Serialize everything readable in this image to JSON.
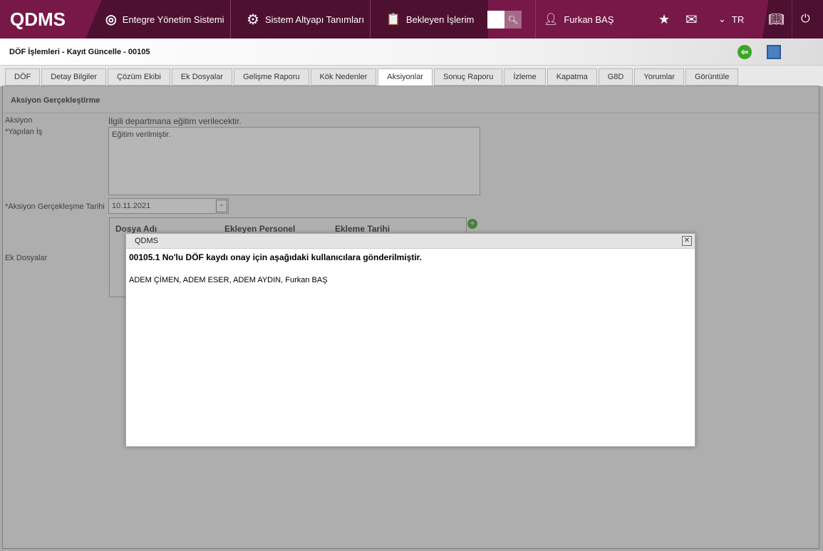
{
  "nav": {
    "logo": "QDMS",
    "items": [
      "Entegre Yönetim Sistemi",
      "Sistem Altyapı Tanımları",
      "Bekleyen İşlerim"
    ],
    "user": "Furkan BAŞ",
    "language": "TR"
  },
  "page": {
    "title": "DÖF İşlemleri - Kayıt Güncelle - 00105"
  },
  "tabs": [
    "DÖF",
    "Detay Bilgiler",
    "Çözüm Ekibi",
    "Ek Dosyalar",
    "Gelişme Raporu",
    "Kök Nedenler",
    "Aksiyonlar",
    "Sonuç Raporu",
    "İzleme",
    "Kapatma",
    "G8D",
    "Yorumlar",
    "Görüntüle"
  ],
  "form": {
    "section_title": "Aksiyon Gerçekleştirme",
    "aksiyon_label": "Aksiyon",
    "aksiyon_value": "İlgili departmana eğitim verilecektir.",
    "yapilan_label": "*Yapılan İş",
    "yapilan_value": "Eğitim verilmiştir.",
    "tarih_label": "*Aksiyon Gerçekleşme Tarihi",
    "tarih_value": "10.11.2021",
    "ek_label": "Ek Dosyalar",
    "columns": [
      "Dosya Adı",
      "Ekleyen Personel",
      "Ekleme Tarihi"
    ]
  },
  "dialog": {
    "title": "QDMS",
    "message": "00105.1 No'lu DÖF kaydı onay için aşağıdaki kullanıcılara gönderilmiştir.",
    "users": "ADEM ÇİMEN, ADEM ESER, ADEM AYDIN, Furkan BAŞ",
    "close": "✕"
  }
}
